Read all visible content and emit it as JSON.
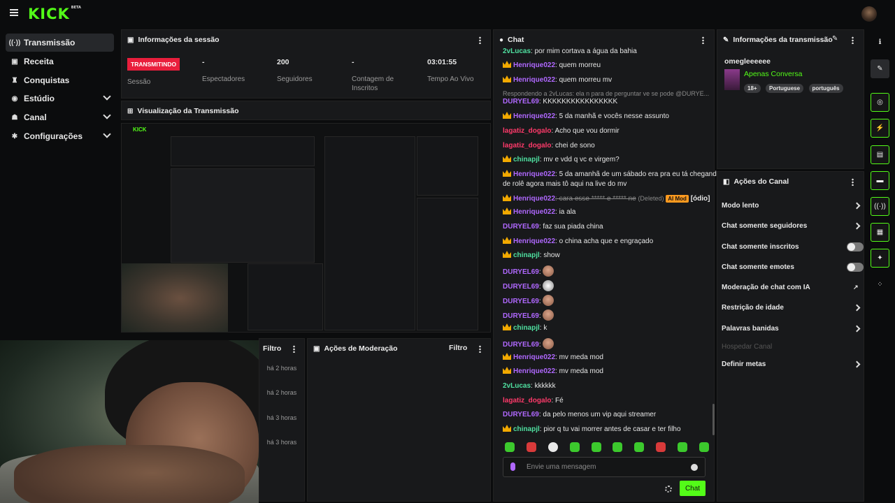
{
  "header": {
    "logo": "KICK",
    "logo_badge": "BETA"
  },
  "sidebar": {
    "items": [
      {
        "label": "Transmissão",
        "icon": "broadcast-icon"
      },
      {
        "label": "Receita",
        "icon": "revenue-icon"
      },
      {
        "label": "Conquistas",
        "icon": "trophy-icon"
      },
      {
        "label": "Estúdio",
        "icon": "studio-icon"
      },
      {
        "label": "Canal",
        "icon": "channel-icon"
      },
      {
        "label": "Configurações",
        "icon": "gear-icon"
      }
    ]
  },
  "session": {
    "title": "Informações da sessão",
    "status": "TRANSMITINDO",
    "status_label": "Sessão",
    "viewers_value": "-",
    "viewers_label": "Espectadores",
    "followers_value": "200",
    "followers_label": "Seguidores",
    "subs_value": "-",
    "subs_label": "Contagem de Inscritos",
    "uptime_value": "03:01:55",
    "uptime_label": "Tempo Ao Vivo"
  },
  "preview": {
    "title": "Visualização da Transmissão"
  },
  "activity": {
    "filter_label": "Filtro",
    "times": [
      "há 2 horas",
      "há 2 horas",
      "há 3 horas",
      "há 3 horas"
    ]
  },
  "moderation": {
    "title": "Ações de Moderação",
    "filter_label": "Filtro"
  },
  "chat": {
    "title": "Chat",
    "reply_note": "Respondendo a 2vLucas: ela n para de perguntar ve se pode @DURYE...",
    "messages": [
      {
        "user": "2vLucas",
        "text": ": por mim cortava a água da bahia"
      },
      {
        "user": "Henrique022",
        "text": ": quem morreu"
      },
      {
        "user": "Henrique022",
        "text": ": quem morreu mv"
      },
      {
        "user": "DURYEL69",
        "text": ": KKKKKKKKKKKKKKKK"
      },
      {
        "user": "Henrique022",
        "text": ": 5 da manhã e vocês nesse assunto"
      },
      {
        "user": "lagatiz_dogalo",
        "text": ": Acho que vou dormir"
      },
      {
        "user": "lagatiz_dogalo",
        "text": ": chei de sono"
      },
      {
        "user": "chinapjl",
        "text": ": mv e vdd q vc e virgem?"
      },
      {
        "user": "Henrique022",
        "text": ": 5 da amanhã de um sábado era pra eu tá chegando"
      },
      {
        "user": "",
        "text": "de rolê agora mais tô aqui na live do mv"
      },
      {
        "user": "Henrique022",
        "text": ": cara esse ***** e ***** ne",
        "deleted": "(Deleted)",
        "ai": "AI Mod",
        "reason": "[ódio]"
      },
      {
        "user": "Henrique022",
        "text": ": ia ala"
      },
      {
        "user": "DURYEL69",
        "text": ": faz sua piada china"
      },
      {
        "user": "Henrique022",
        "text": ": o china acha que e engraçado"
      },
      {
        "user": "chinapjl",
        "text": ": show"
      },
      {
        "user": "DURYEL69",
        "text": ":"
      },
      {
        "user": "DURYEL69",
        "text": ":"
      },
      {
        "user": "DURYEL69",
        "text": ":"
      },
      {
        "user": "DURYEL69",
        "text": ":"
      },
      {
        "user": "chinapjl",
        "text": ": k"
      },
      {
        "user": "DURYEL69",
        "text": ":"
      },
      {
        "user": "Henrique022",
        "text": ": mv meda mod"
      },
      {
        "user": "Henrique022",
        "text": ": mv meda mod"
      },
      {
        "user": "2vLucas",
        "text": ": kkkkkk"
      },
      {
        "user": "lagatiz_dogalo",
        "text": ": Fé"
      },
      {
        "user": "DURYEL69",
        "text": ": da pelo menos um vip aqui streamer"
      },
      {
        "user": "chinapjl",
        "text": ": pior q tu vai morrer antes de casar e ter filho"
      }
    ],
    "input_placeholder": "Envie uma mensagem",
    "send_label": "Chat"
  },
  "stream_info": {
    "title": "Informações da transmissão",
    "stream_title": "omegleeeeee",
    "category": "Apenas Conversa",
    "tags": [
      "18+",
      "Portuguese",
      "português"
    ]
  },
  "channel_actions": {
    "title": "Ações do Canal",
    "items": [
      {
        "label": "Modo lento",
        "kind": "chevron"
      },
      {
        "label": "Chat somente seguidores",
        "kind": "chevron"
      },
      {
        "label": "Chat somente inscritos",
        "kind": "toggle"
      },
      {
        "label": "Chat somente emotes",
        "kind": "toggle"
      },
      {
        "label": "Moderação de chat com IA",
        "kind": "external"
      },
      {
        "label": "Restrição de idade",
        "kind": "chevron"
      },
      {
        "label": "Palavras banidas",
        "kind": "chevron"
      },
      {
        "label": "Hospedar Canal",
        "kind": "disabled"
      },
      {
        "label": "Definir metas",
        "kind": "chevron"
      }
    ]
  },
  "colors": {
    "accent": "#53fc18",
    "live": "#e91e3c",
    "bg": "#0b0c0d",
    "panel": "#18191b"
  }
}
